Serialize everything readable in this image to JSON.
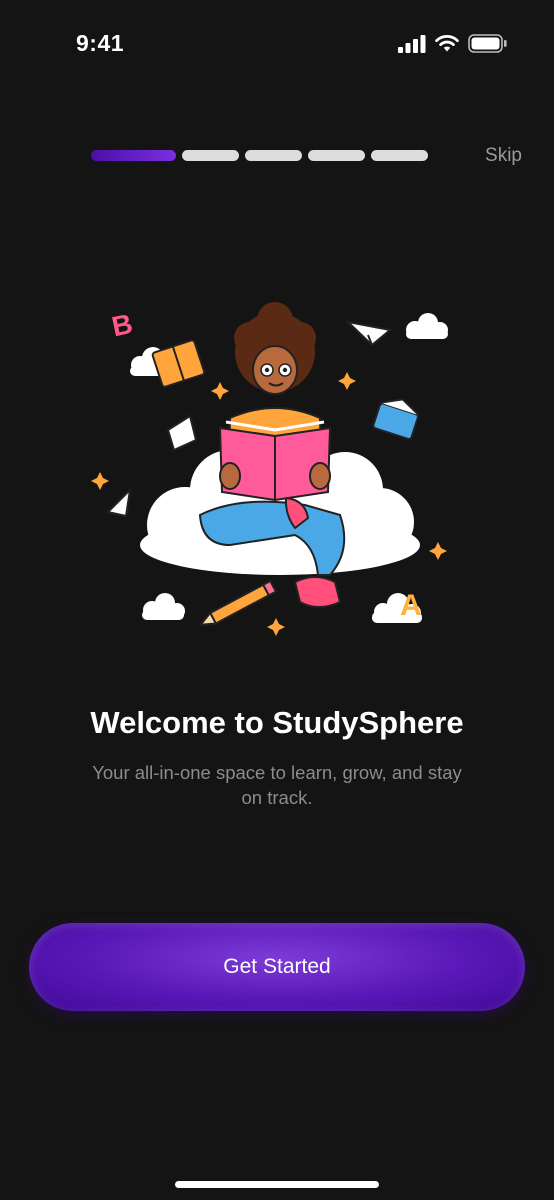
{
  "status_bar": {
    "time": "9:41"
  },
  "onboarding": {
    "total_steps": 5,
    "current_step": 1,
    "skip_label": "Skip"
  },
  "content": {
    "title": "Welcome to StudySphere",
    "subtitle": "Your all-in-one space to learn, grow, and stay on track.",
    "illustration_text": {
      "letter_b": "B",
      "letter_a": "A"
    }
  },
  "actions": {
    "primary_label": "Get Started"
  },
  "colors": {
    "background": "#141414",
    "accent": "#5a17b8",
    "progress_inactive": "#dcdcdc",
    "subtitle": "#8c8c8c"
  }
}
